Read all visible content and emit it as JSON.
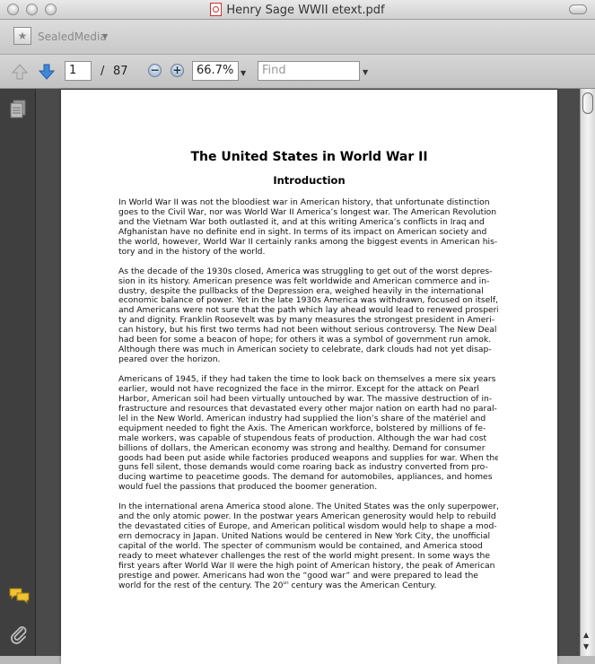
{
  "window": {
    "title": "Henry Sage WWII etext.pdf"
  },
  "sealbar": {
    "label": "SealedMedia"
  },
  "toolbar": {
    "page_current": "1",
    "page_separator": "/",
    "page_total": "87",
    "zoom": "66.7%",
    "find_placeholder": "Find"
  },
  "document": {
    "title": "The United States in World War II",
    "subtitle": "Introduction",
    "paragraphs": [
      [
        "In World War II was not the bloodiest war in American history, that unfortunate distinction",
        "goes to the Civil War, nor was World War II America’s longest war. The American Revolution",
        "and the Vietnam War both outlasted it, and at this writing America’s conflicts in Iraq and",
        "Afghanistan have no definite end in sight. In terms of its impact on American society and",
        "the world, however, World War II certainly ranks among the biggest events in American his-",
        "tory and in the history of the world."
      ],
      [
        "As the decade of the 1930s closed, America was struggling to get out of the worst depres-",
        "sion in its history. American presence was felt worldwide and American commerce and in-",
        "dustry, despite the pullbacks of the Depression era, weighed heavily in the international",
        "economic balance of power. Yet in the late 1930s America was withdrawn, focused on itself,",
        "and Americans were not sure that the path which lay ahead would lead to renewed prosperi-",
        "ty and dignity. Franklin Roosevelt was by many measures the strongest president in Ameri-",
        "can history, but his first two terms had not been without serious controversy. The New Deal",
        "had been for some a beacon of hope; for others it was a symbol of government run amok.",
        "Although there was much in American society to celebrate, dark clouds had not yet disap-",
        "peared over the horizon."
      ],
      [
        "Americans of 1945, if they had taken the time to look back on themselves a mere six years",
        "earlier, would not have recognized the face in the mirror. Except for the attack on Pearl",
        "Harbor, American soil had been virtually untouched by war. The massive destruction of in-",
        "frastructure and resources that devastated every other major nation on earth had no paral-",
        "lel in the New World. American industry had supplied the lion’s share of the matériel and",
        "equipment needed to fight the Axis. The American workforce, bolstered by millions of fe-",
        "male workers, was capable of stupendous feats of production. Although the war had cost",
        "billions of dollars, the American economy was strong and healthy. Demand for consumer",
        "goods had been put aside while factories produced weapons and supplies for war. When the",
        "guns fell silent, those demands would come roaring back as industry converted from pro-",
        "ducing wartime to peacetime goods. The demand for automobiles, appliances, and homes",
        "would fuel the passions that produced the boomer generation."
      ],
      [
        "In the international arena America stood alone. The United States was the only superpower,",
        "and the only atomic power. In the postwar years American generosity would help to rebuild",
        "the devastated cities of Europe, and American political wisdom would help to shape a mod-",
        "ern democracy in Japan. United Nations would be centered in New York City, the unofficial",
        "capital of the world. The specter of communism would be contained, and America stood",
        "ready to meet whatever challenges the rest of the world might present. In some ways the",
        "first years after World War II were the high point of American history, the peak of American",
        "prestige and power. Americans had won the “good war” and were prepared to lead the"
      ]
    ],
    "last_line_before": "world for the rest of the century. The 20",
    "last_line_sup": "th",
    "last_line_after": " century was the American Century."
  }
}
